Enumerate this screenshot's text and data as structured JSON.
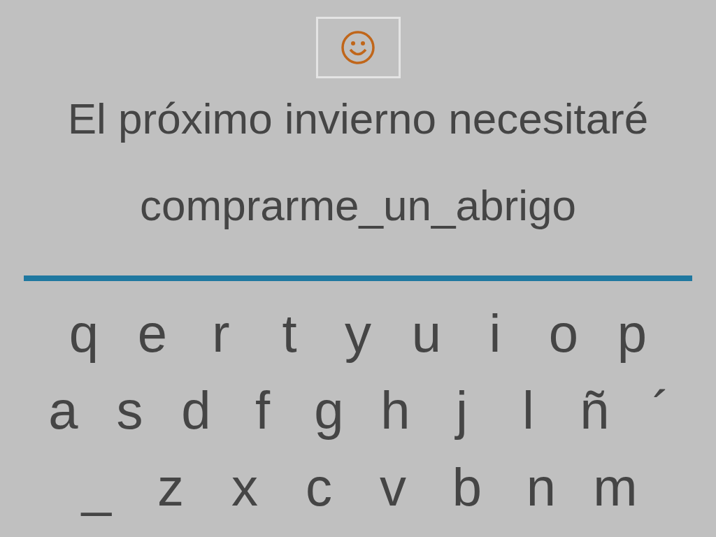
{
  "sentence": "El próximo invierno necesitaré",
  "answer": "comprarme_un_abrigo",
  "keyboard": [
    [
      "q",
      "e",
      "r",
      "t",
      "y",
      "u",
      "i",
      "o",
      "p"
    ],
    [
      "a",
      "s",
      "d",
      "f",
      "g",
      "h",
      "j",
      "l",
      "ñ",
      "´"
    ],
    [
      "_",
      "z",
      "x",
      "c",
      "v",
      "b",
      "n",
      "m"
    ]
  ]
}
